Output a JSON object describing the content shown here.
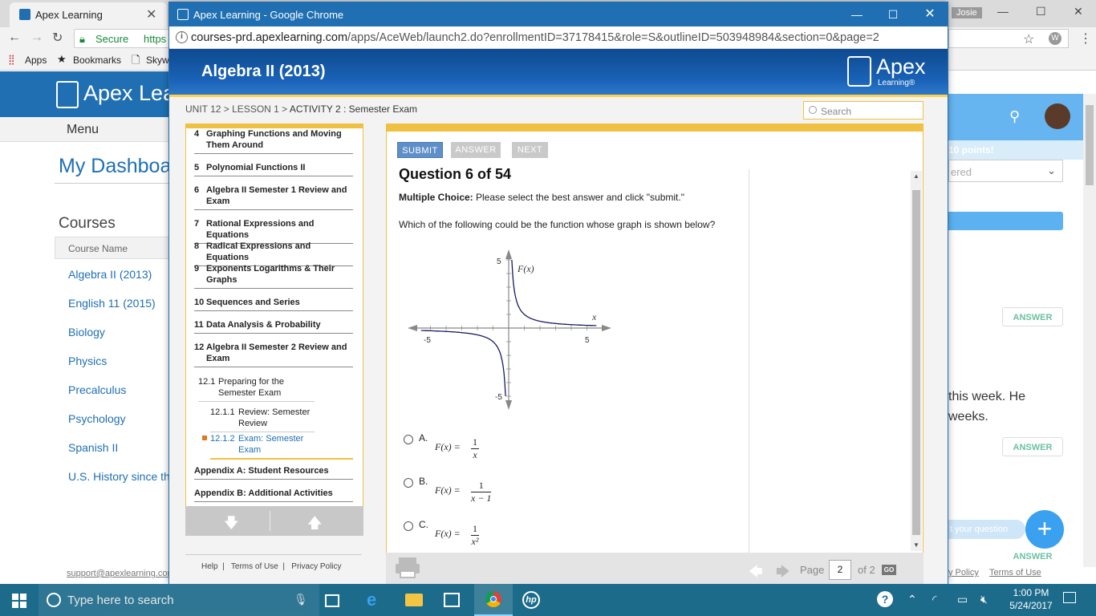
{
  "bg_browser": {
    "tab_title": "Apex Learning",
    "user_name": "Josie",
    "secure_label": "Secure",
    "url_prefix": "https",
    "bookmarks": [
      "Apps",
      "Bookmarks",
      "Skyw"
    ],
    "logo_text": "Apex Learn",
    "menu": "Menu",
    "dashboard_title": "My Dashboar",
    "courses_heading": "Courses",
    "course_col": "Course Name",
    "courses": [
      "Algebra II (2013)",
      "English 11 (2015)",
      "Biology",
      "Physics",
      "Precalculus",
      "Psychology",
      "Spanish II",
      "U.S. History since th"
    ],
    "support_email": "support@apexlearning.com",
    "right_points": "10 points!",
    "right_select": "ered",
    "answer_label": "ANSWER",
    "right_text_1": "this week. He",
    "right_text_2": "weeks.",
    "ask_label": "t your question",
    "footer_links": [
      "y Policy",
      "Terms of Use"
    ]
  },
  "popup": {
    "window_title": "Apex Learning - Google Chrome",
    "url_host": "courses-prd.apexlearning.com",
    "url_path": "/apps/AceWeb/launch2.do?enrollmentID=37178415&role=S&outlineID=503948984&section=0&page=2",
    "course_title": "Algebra II (2013)",
    "logo_word": "Apex",
    "logo_sub": "Learning®",
    "breadcrumb_prefix": "UNIT 12 > LESSON 1 > ",
    "breadcrumb_current": "ACTIVITY 2 : Semester Exam",
    "search_placeholder": "Search"
  },
  "nav": [
    {
      "num": "4",
      "label": "Graphing Functions and Moving Them Around"
    },
    {
      "num": "5",
      "label": "Polynomial Functions II"
    },
    {
      "num": "6",
      "label": "Algebra II Semester 1 Review and Exam"
    },
    {
      "num": "7",
      "label": "Rational Expressions and Equations"
    },
    {
      "num": "8",
      "label": "Radical Expressions and Equations"
    },
    {
      "num": "9",
      "label": "Exponents Logarithms & Their Graphs"
    },
    {
      "num": "10",
      "label": "Sequences and Series"
    },
    {
      "num": "11",
      "label": "Data Analysis & Probability"
    },
    {
      "num": "12",
      "label": "Algebra II Semester 2 Review and Exam"
    }
  ],
  "nav_sub": [
    {
      "num": "12.1",
      "label": "Preparing for the Semester Exam"
    },
    {
      "num": "12.1.1",
      "label": "Review: Semester Review"
    },
    {
      "num": "12.1.2",
      "label": "Exam: Semester Exam"
    }
  ],
  "nav_appendix": [
    "Appendix A: Student Resources",
    "Appendix B: Additional Activities"
  ],
  "footer": [
    "Help",
    "Terms of Use",
    "Privacy Policy"
  ],
  "toolbar": {
    "submit": "SUBMIT",
    "answer": "ANSWER",
    "next": "NEXT"
  },
  "question": {
    "title": "Question 6 of 54",
    "type_label": "Multiple Choice:",
    "type_text": " Please select the best answer and click \"submit.\"",
    "prompt": "Which of the following could be the function whose graph is shown below?"
  },
  "chart_data": {
    "type": "line",
    "ylabel": "F(x)",
    "xlabel": "x",
    "xlim": [
      -5,
      5
    ],
    "ylim": [
      -5,
      5
    ],
    "tick_labels": {
      "x_min": "-5",
      "x_max": "5",
      "y_min": "-5",
      "y_max": "5"
    },
    "series": [
      {
        "values": "1/x"
      }
    ]
  },
  "options": [
    {
      "letter": "A.",
      "lhs": "F(x) =",
      "num": "1",
      "den": "x"
    },
    {
      "letter": "B.",
      "lhs": "F(x) =",
      "num": "1",
      "den": "x − 1"
    },
    {
      "letter": "C.",
      "lhs": "F(x) =",
      "num": "1",
      "den": "x²"
    }
  ],
  "pager": {
    "label": "Page",
    "current": "2",
    "of": "of 2",
    "go": "GO"
  },
  "taskbar": {
    "search_placeholder": "Type here to search",
    "time": "1:00 PM",
    "date": "5/24/2017"
  },
  "colors": {
    "brand_blue": "#1f6fb2",
    "accent_yellow": "#f0c040",
    "submit": "#5f8fc9",
    "disabled": "#c9c9c9",
    "taskbar": "#1d6b8a"
  }
}
